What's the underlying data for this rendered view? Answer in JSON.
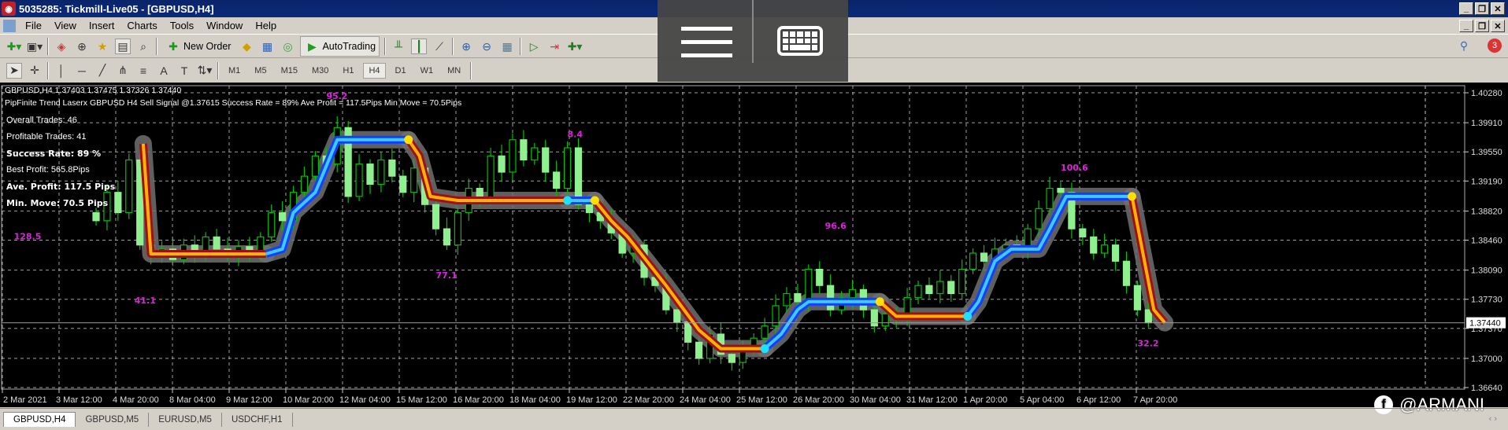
{
  "window": {
    "title": "5035285: Tickmill-Live05 - [GBPUSD,H4]"
  },
  "menu": [
    "File",
    "View",
    "Insert",
    "Charts",
    "Tools",
    "Window",
    "Help"
  ],
  "toolbar": {
    "new_order": "New Order",
    "autotrading": "AutoTrading",
    "notification_count": "3"
  },
  "timeframes": [
    "M1",
    "M5",
    "M15",
    "M30",
    "H1",
    "H4",
    "D1",
    "W1",
    "MN"
  ],
  "active_timeframe": "H4",
  "chart": {
    "header": "GBPUSD,H4  1.37403 1.37475 1.37326 1.37440",
    "indicator_line": "PipFinite Trend Laserx  GBPUSD H4 Sell Signal @1.37615 Success Rate = 89% Ave Profit = 117.5Pips Min Move = 70.5Pips",
    "stats": [
      {
        "text": "Overall Trades: 46",
        "bold": false
      },
      {
        "text": "Profitable Trades: 41",
        "bold": false
      },
      {
        "text": "Success Rate: 89 %",
        "bold": true
      },
      {
        "text": "Best Profit: 565.8Pips",
        "bold": false
      },
      {
        "text": "Ave. Profit: 117.5 Pips",
        "bold": true
      },
      {
        "text": "Min. Move: 70.5 Pips",
        "bold": true
      }
    ],
    "current_price": "1.37440",
    "watermark": "@ARMANI"
  },
  "chart_data": {
    "type": "candlestick",
    "symbol": "GBPUSD",
    "timeframe": "H4",
    "ylim": [
      1.3664,
      1.4028
    ],
    "price_ticks": [
      "1.40280",
      "1.39910",
      "1.39550",
      "1.39190",
      "1.38820",
      "1.38460",
      "1.38090",
      "1.37730",
      "1.37370",
      "1.37000",
      "1.36640"
    ],
    "time_ticks": [
      "2 Mar 2021",
      "3 Mar 12:00",
      "4 Mar 20:00",
      "8 Mar 04:00",
      "9 Mar 12:00",
      "10 Mar 20:00",
      "12 Mar 04:00",
      "15 Mar 12:00",
      "16 Mar 20:00",
      "18 Mar 04:00",
      "19 Mar 12:00",
      "22 Mar 20:00",
      "24 Mar 04:00",
      "25 Mar 12:00",
      "26 Mar 20:00",
      "30 Mar 04:00",
      "31 Mar 12:00",
      "1 Apr 20:00",
      "5 Apr 04:00",
      "6 Apr 12:00",
      "7 Apr 20:00"
    ],
    "closes": [
      1.387,
      1.3905,
      1.388,
      1.3945,
      1.384,
      1.3828,
      1.3835,
      1.3822,
      1.384,
      1.383,
      1.385,
      1.3835,
      1.3826,
      1.3838,
      1.383,
      1.385,
      1.388,
      1.387,
      1.3905,
      1.3925,
      1.395,
      1.394,
      1.3985,
      1.39,
      1.394,
      1.3915,
      1.3945,
      1.3925,
      1.3905,
      1.3935,
      1.389,
      1.386,
      1.384,
      1.388,
      1.391,
      1.3895,
      1.395,
      1.393,
      1.397,
      1.3945,
      1.396,
      1.393,
      1.391,
      1.396,
      1.389,
      1.388,
      1.387,
      1.3855,
      1.383,
      1.384,
      1.38,
      1.379,
      1.376,
      1.3745,
      1.372,
      1.37,
      1.373,
      1.3705,
      1.3695,
      1.371,
      1.3725,
      1.374,
      1.3765,
      1.378,
      1.377,
      1.381,
      1.379,
      1.376,
      1.3775,
      1.3785,
      1.376,
      1.374,
      1.3755,
      1.375,
      1.3775,
      1.379,
      1.378,
      1.3795,
      1.378,
      1.381,
      1.383,
      1.382,
      1.3835,
      1.384,
      1.3835,
      1.386,
      1.3885,
      1.391,
      1.3905,
      1.386,
      1.385,
      1.383,
      1.384,
      1.382,
      1.379,
      1.376,
      1.3744
    ],
    "laser": [
      {
        "trend": "down",
        "points": [
          [
            4.3,
            1.3965
          ],
          [
            5,
            1.3829
          ],
          [
            15.5,
            1.3829
          ]
        ]
      },
      {
        "trend": "up",
        "points": [
          [
            15.5,
            1.3829
          ],
          [
            17,
            1.3835
          ],
          [
            18,
            1.388
          ],
          [
            20,
            1.3905
          ],
          [
            22,
            1.397
          ],
          [
            28.5,
            1.397
          ]
        ]
      },
      {
        "trend": "down",
        "points": [
          [
            28.5,
            1.397
          ],
          [
            29.5,
            1.395
          ],
          [
            30.5,
            1.39
          ],
          [
            33,
            1.3895
          ],
          [
            43,
            1.3895
          ]
        ]
      },
      {
        "trend": "up",
        "points": [
          [
            43,
            1.3895
          ],
          [
            45.5,
            1.3895
          ]
        ]
      },
      {
        "trend": "down",
        "points": [
          [
            45.5,
            1.3895
          ],
          [
            47,
            1.387
          ],
          [
            48.5,
            1.385
          ],
          [
            52,
            1.379
          ],
          [
            55,
            1.3735
          ],
          [
            57,
            1.3712
          ],
          [
            61,
            1.3712
          ]
        ]
      },
      {
        "trend": "up",
        "points": [
          [
            61,
            1.3712
          ],
          [
            62.5,
            1.373
          ],
          [
            64,
            1.376
          ],
          [
            65,
            1.377
          ],
          [
            71.5,
            1.377
          ]
        ]
      },
      {
        "trend": "down",
        "points": [
          [
            71.5,
            1.377
          ],
          [
            73,
            1.3752
          ],
          [
            79.5,
            1.3752
          ]
        ]
      },
      {
        "trend": "up",
        "points": [
          [
            79.5,
            1.3752
          ],
          [
            80.5,
            1.377
          ],
          [
            82,
            1.382
          ],
          [
            83.5,
            1.3835
          ],
          [
            86,
            1.3835
          ],
          [
            87,
            1.386
          ],
          [
            88.5,
            1.39
          ],
          [
            94.5,
            1.39
          ]
        ]
      },
      {
        "trend": "down",
        "points": [
          [
            94.5,
            1.39
          ],
          [
            95.5,
            1.383
          ],
          [
            96.5,
            1.376
          ],
          [
            97.5,
            1.3744
          ]
        ]
      }
    ],
    "sell_dots": [
      [
        28.5,
        1.397
      ],
      [
        45.5,
        1.3895
      ],
      [
        71.5,
        1.377
      ],
      [
        94.5,
        1.39
      ]
    ],
    "buy_dots": [
      [
        43,
        1.3895
      ],
      [
        61,
        1.3712
      ],
      [
        79.5,
        1.3752
      ]
    ],
    "annotations": [
      {
        "text": "128.5",
        "i": -7.5,
        "p": 1.3847
      },
      {
        "text": "41.1",
        "i": 3.5,
        "p": 1.3768
      },
      {
        "text": "95.2",
        "i": 21,
        "p": 1.402
      },
      {
        "text": "8.4",
        "i": 43,
        "p": 1.3973
      },
      {
        "text": "77.1",
        "i": 31,
        "p": 1.3799
      },
      {
        "text": "96.6",
        "i": 66.5,
        "p": 1.386
      },
      {
        "text": "100.6",
        "i": 88,
        "p": 1.3932
      },
      {
        "text": "32.2",
        "i": 95,
        "p": 1.3715
      }
    ],
    "colors": {
      "bull": "#90f090",
      "bear": "#00c000",
      "up_inner": "#40c8ff",
      "up_outer": "#1040ff",
      "down_inner": "#ffb000",
      "down_outer": "#a01010",
      "glow": "#707070",
      "grid": "#c8c8c8",
      "annotation": "#e020e0",
      "sell_dot": "#ffe000",
      "buy_dot": "#20e0ff"
    }
  },
  "tabs": [
    "GBPUSD,H4",
    "GBPUSD,M5",
    "EURUSD,M5",
    "USDCHF,H1"
  ],
  "active_tab": "GBPUSD,H4"
}
